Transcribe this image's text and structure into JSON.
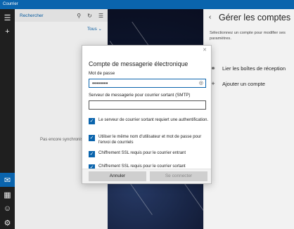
{
  "window": {
    "title": "Courrier"
  },
  "list": {
    "search_label": "Rechercher",
    "filter_label": "Tous",
    "empty_message": "Pas encore synchronisé"
  },
  "settings": {
    "title": "Gérer les comptes",
    "description": "Sélectionnez un compte pour modifier ses paramètres.",
    "items": [
      {
        "label": "Lier les boîtes de réception",
        "icon": "link-icon"
      },
      {
        "label": "Ajouter un compte",
        "icon": "add-icon"
      }
    ]
  },
  "dialog": {
    "title": "Compte de messagerie électronique",
    "password_label": "Mot de passe",
    "password_value": "••••••••",
    "smtp_label": "Serveur de messagerie pour courrier sortant (SMTP)",
    "smtp_value": "",
    "checkboxes": [
      {
        "label": "Le serveur de courrier sortant requiert une authentification.",
        "checked": true
      },
      {
        "label": "Utiliser le même nom d'utilisateur et mot de passe pour l'envoi de courriels",
        "checked": true
      },
      {
        "label": "Chiffrement SSL requis pour le courrier entrant",
        "checked": true
      },
      {
        "label": "Chiffrement SSL requis pour le courrier sortant",
        "checked": true
      }
    ],
    "cancel_label": "Annuler",
    "connect_label": "Se connecter"
  },
  "colors": {
    "accent": "#0a64ad",
    "titlebar": "#0a64ad",
    "nav_bg": "#1f1f1f"
  }
}
